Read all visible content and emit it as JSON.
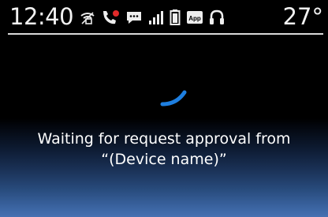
{
  "status_bar": {
    "time": "12:40",
    "temperature": "27°",
    "icons": [
      "wifi-off-icon",
      "missed-call-icon",
      "message-icon",
      "signal-bars-icon",
      "battery-icon",
      "app-icon",
      "headset-icon"
    ],
    "app_badge_label": "App"
  },
  "dialog": {
    "message_line1": "Waiting for request approval from",
    "message_line2": "“(Device name)”"
  },
  "colors": {
    "spinner": "#1e7fe0",
    "background_glow": "#4670b2",
    "missed_call_red": "#e12a2a"
  }
}
